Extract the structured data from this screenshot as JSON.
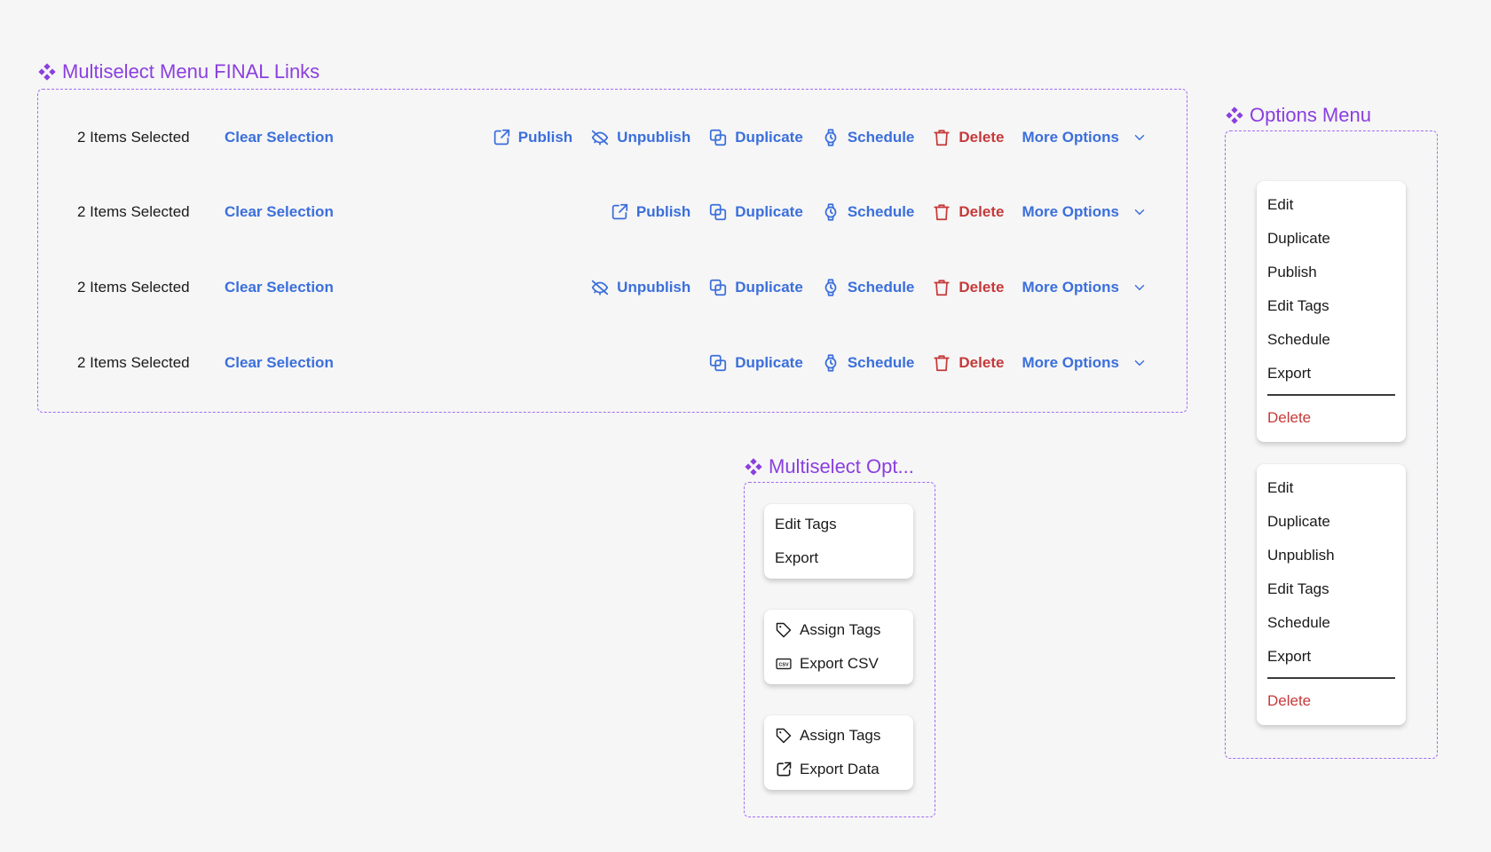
{
  "colors": {
    "accent": "#3b6fdb",
    "danger": "#c6393a",
    "component_purple": "#8a3fe0",
    "background": "#f6f6f6"
  },
  "sets": {
    "links_title": "Multiselect Menu FINAL Links",
    "options_title": "Options Menu",
    "multiselect_options_title": "Multiselect Opt..."
  },
  "bars": [
    {
      "count": "2 Items Selected",
      "clear": "Clear Selection",
      "actions": {
        "publish": "Publish",
        "unpublish": "Unpublish",
        "duplicate": "Duplicate",
        "schedule": "Schedule",
        "delete": "Delete",
        "more": "More Options"
      }
    },
    {
      "count": "2 Items Selected",
      "clear": "Clear Selection",
      "actions": {
        "publish": "Publish",
        "duplicate": "Duplicate",
        "schedule": "Schedule",
        "delete": "Delete",
        "more": "More Options"
      }
    },
    {
      "count": "2 Items Selected",
      "clear": "Clear Selection",
      "actions": {
        "unpublish": "Unpublish",
        "duplicate": "Duplicate",
        "schedule": "Schedule",
        "delete": "Delete",
        "more": "More Options"
      }
    },
    {
      "count": "2 Items Selected",
      "clear": "Clear Selection",
      "actions": {
        "duplicate": "Duplicate",
        "schedule": "Schedule",
        "delete": "Delete",
        "more": "More Options"
      }
    }
  ],
  "options_menus": [
    {
      "items": [
        "Edit",
        "Duplicate",
        "Publish",
        "Edit Tags",
        "Schedule",
        "Export"
      ],
      "danger": "Delete"
    },
    {
      "items": [
        "Edit",
        "Duplicate",
        "Unpublish",
        "Edit Tags",
        "Schedule",
        "Export"
      ],
      "danger": "Delete"
    }
  ],
  "multiselect_options": [
    {
      "items": [
        {
          "label": "Edit Tags"
        },
        {
          "label": "Export"
        }
      ]
    },
    {
      "items": [
        {
          "label": "Assign Tags",
          "icon": "tag-icon"
        },
        {
          "label": "Export CSV",
          "icon": "csv-icon"
        }
      ]
    },
    {
      "items": [
        {
          "label": "Assign Tags",
          "icon": "tag-icon"
        },
        {
          "label": "Export Data",
          "icon": "external-link-icon"
        }
      ]
    }
  ]
}
